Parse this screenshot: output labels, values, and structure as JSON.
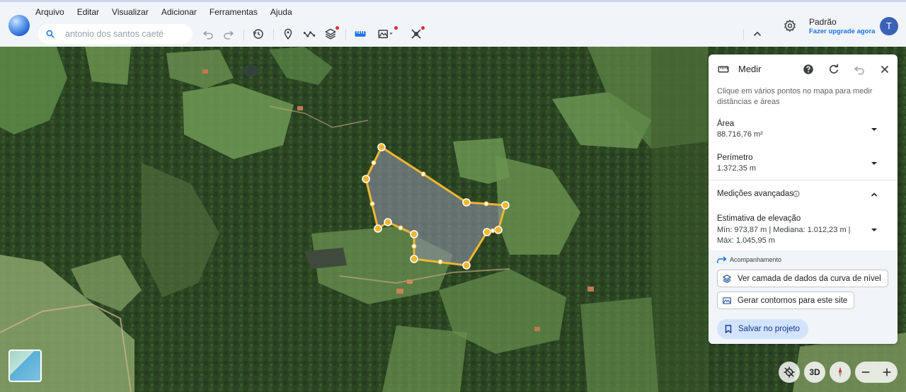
{
  "menu": [
    "Arquivo",
    "Editar",
    "Visualizar",
    "Adicionar",
    "Ferramentas",
    "Ajuda"
  ],
  "search": {
    "placeholder": "antonio dos santos caeté"
  },
  "toolbar_icons": [
    "undo-icon",
    "redo-icon",
    "history-icon",
    "placemark-icon",
    "path-icon",
    "layers-icon",
    "ruler-icon",
    "terrain-icon",
    "tools-icon",
    "chevron-up-icon"
  ],
  "profile": {
    "name": "Padrão",
    "upgrade": "Fazer upgrade agora",
    "avatar_letter": "T"
  },
  "measure": {
    "title": "Medir",
    "instruction": "Clique em vários pontos no mapa para medir distâncias e áreas",
    "area_label": "Área",
    "area_value": "88.716,76 m²",
    "perimeter_label": "Perímetro",
    "perimeter_value": "1.372,35 m",
    "advanced_label": "Medições avançadas",
    "elevation_label": "Estimativa de elevação",
    "elevation_line1": "Mín: 973,87 m | Mediana: 1.012,23 m |",
    "elevation_line2": "Máx: 1.045,95 m",
    "tracking_label": "Acompanhamento",
    "btn_contour_layer": "Ver camada de dados da curva de nível",
    "btn_generate_contours": "Gerar contornos para este site",
    "btn_save": "Salvar no projeto"
  },
  "map_controls": {
    "three_d": "3D"
  },
  "colors": {
    "accent": "#1a73e8",
    "polygon_stroke": "#f2b632",
    "save_button": "#d3e3fd"
  }
}
